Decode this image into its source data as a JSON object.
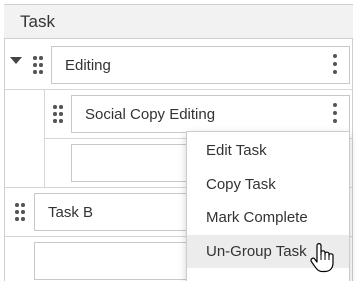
{
  "header": {
    "column_label": "Task"
  },
  "tasks": [
    {
      "label": "Editing",
      "expanded": true
    },
    {
      "label": "Social Copy Editing"
    },
    {
      "label": ""
    },
    {
      "label": "Task B"
    },
    {
      "label": ""
    }
  ],
  "context_menu": {
    "items": [
      {
        "label": "Edit Task"
      },
      {
        "label": "Copy Task"
      },
      {
        "label": "Mark Complete"
      },
      {
        "label": "Un-Group Task",
        "hovered": true
      }
    ]
  },
  "icons": {
    "toggle": "caret-down-icon",
    "drag": "drag-handle-icon",
    "more": "kebab-menu-icon",
    "cursor": "hand-pointer-icon"
  },
  "colors": {
    "header_bg": "#f2f2f2",
    "border": "#cfcfcf",
    "menu_hover_bg": "#ececec",
    "text": "#333333"
  }
}
